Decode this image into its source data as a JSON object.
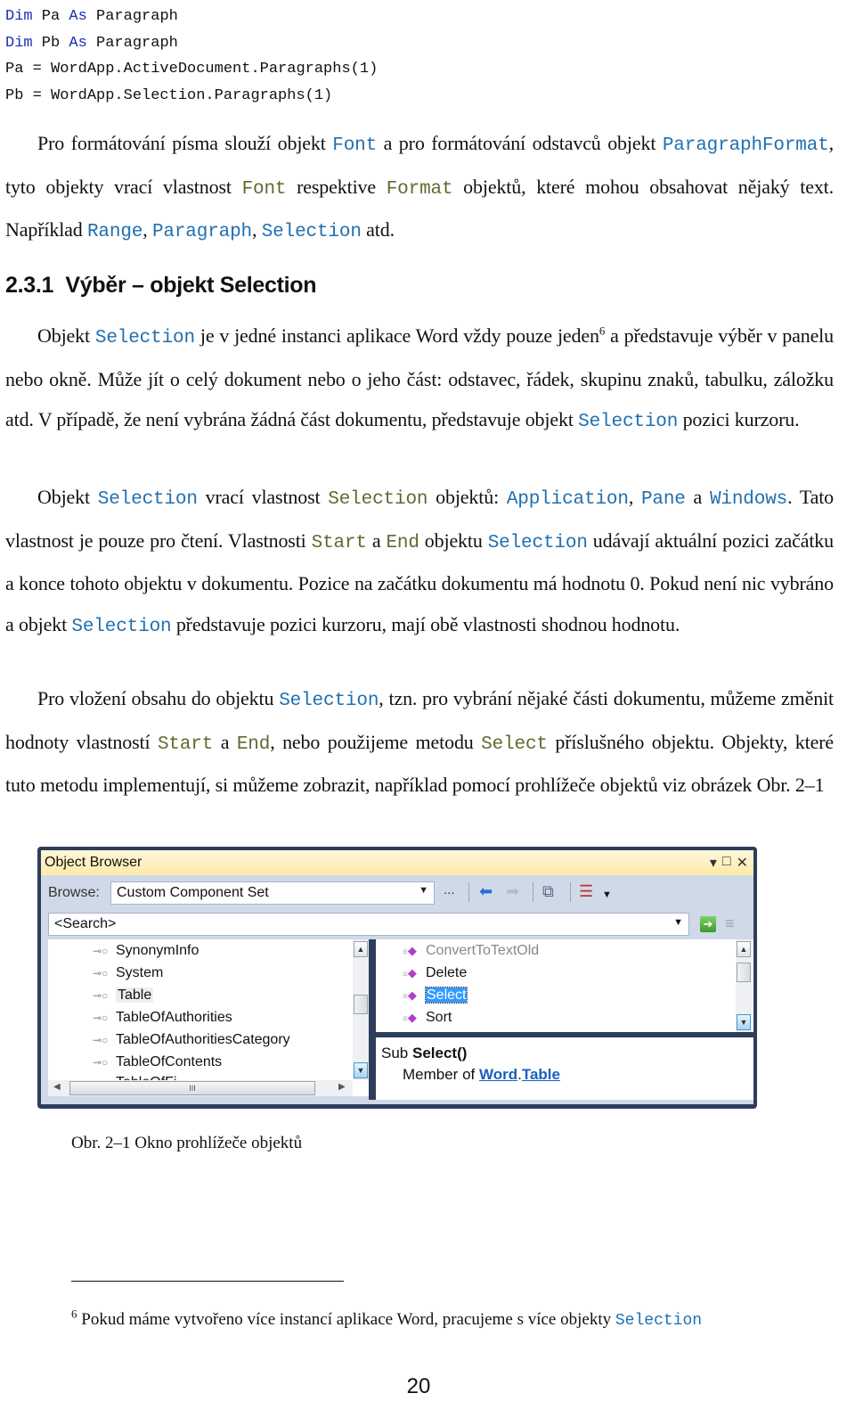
{
  "code": {
    "lines": [
      {
        "kw1": "Dim",
        "var": " Pa ",
        "kw2": "As",
        "type": " Paragraph"
      },
      {
        "kw1": "Dim",
        "var": " Pb ",
        "kw2": "As",
        "type": " Paragraph"
      },
      {
        "text": "Pa = WordApp.ActiveDocument.Paragraphs(1)"
      },
      {
        "text": "Pb = WordApp.Selection.Paragraphs(1)"
      }
    ]
  },
  "para1": {
    "t1": "Pro formátování písma slouží objekt ",
    "c1": "Font",
    "t2": " a pro formátování odstavců objekt ",
    "c2": "ParagraphFormat",
    "t3": ", tyto objekty vrací vlastnost ",
    "p1": "Font",
    "t4": " respektive ",
    "p2": "Format",
    "t5": " objektů, kte­ré mohou obsahovat nějaký text. Například ",
    "c3": "Range",
    "t6": ", ",
    "c4": "Paragraph",
    "t7": ", ",
    "c5": "Selection",
    "t8": " atd."
  },
  "heading": "2.3.1  Výběr – objekt Selection",
  "para2": {
    "t1": "Objekt ",
    "c1": "Selection",
    "t2": " je v jedné instanci aplikace Word vždy pouze jeden",
    "sup": "6",
    "t3": " a představuje výběr v panelu nebo okně. Může jít o celý dokument nebo o jeho část: odstavec, řádek, skupinu znaků, tabulku, záložku atd. V případě, že není vybrána žád­ná část dokumentu, představuje objekt ",
    "c2": "Selection",
    "t4": " pozici kurzoru."
  },
  "para3": {
    "t1": "Objekt ",
    "c1": "Selection",
    "t2": " vrací vlastnost ",
    "p1": "Selection",
    "t3": " objektů: ",
    "c2": "Application",
    "t4": ", ",
    "c3": "Pane",
    "t5": " a ",
    "c4": "Windows",
    "t6": ". Tato vlastnost je pouze pro čtení. Vlastnosti ",
    "p2": "Start",
    "t7": " a ",
    "p3": "End",
    "t8": " objektu ",
    "c5": "Selection",
    "t9": " udávají aktuální pozici začátku a konce tohoto objektu v dokumentu. Po­zice na začátku dokumentu má hodnotu 0. Pokud není nic vybráno a objekt ",
    "c6": "Selection",
    "t10": " představuje pozici kurzoru, mají obě vlastnosti shodnou hodnotu."
  },
  "para4": {
    "t1": "Pro vložení obsahu do objektu ",
    "c1": "Selection",
    "t2": ", tzn. pro vybrání nějaké části dokumen­tu, můžeme změnit hodnoty vlastností ",
    "p1": "Start",
    "t3": " a ",
    "p2": "End",
    "t4": ", nebo použijeme metodu ",
    "p3": "Select",
    "t5": " příslušného objektu. Objekty, které tuto metodu implementují, si můžeme zobrazit, například pomocí prohlížeče objektů viz obrázek Obr. 2–1"
  },
  "object_browser": {
    "title": "Object Browser",
    "title_buttons": {
      "dropdown": "▾",
      "maximize": "□",
      "close": "✕"
    },
    "browse_label": "Browse:",
    "browse_value": "Custom Component Set",
    "ellipsis": "...",
    "search_placeholder": "<Search>",
    "icons": {
      "back": "⬅",
      "forward": "➡",
      "add_reference": "⧉",
      "settings": "☰",
      "go": "➔",
      "clear": "≡"
    },
    "tree_items": [
      {
        "label": "SynonymInfo",
        "selected": false
      },
      {
        "label": "System",
        "selected": false
      },
      {
        "label": "Table",
        "selected": true
      },
      {
        "label": "TableOfAuthorities",
        "selected": false
      },
      {
        "label": "TableOfAuthoritiesCategory",
        "selected": false
      },
      {
        "label": "TableOfContents",
        "selected": false
      },
      {
        "label": "TableOfFi...",
        "selected": false
      }
    ],
    "members": [
      {
        "label": "ConvertToTextOld",
        "dimmed": true,
        "selected": false
      },
      {
        "label": "Delete",
        "dimmed": false,
        "selected": false
      },
      {
        "label": "Select",
        "dimmed": false,
        "selected": true
      },
      {
        "label": "Sort",
        "dimmed": false,
        "selected": false
      }
    ],
    "description": {
      "prefix": "Sub ",
      "name": "Select()",
      "member_of": "Member of ",
      "namespace": "Word",
      "dot": ".",
      "class": "Table"
    },
    "hscroll_grip": "III"
  },
  "caption": "Obr. 2–1 Okno prohlížeče objektů",
  "footnote": {
    "num": "6",
    "text": " Pokud máme vytvořeno více instancí aplikace Word, pracujeme s více objekty ",
    "cls": "Selection"
  },
  "page_number": "20",
  "colors": {
    "keyword": "#1a2fb4",
    "class_name": "#1f6fb0",
    "property_name": "#5f6a2e",
    "selection_highlight": "#3399ff"
  }
}
